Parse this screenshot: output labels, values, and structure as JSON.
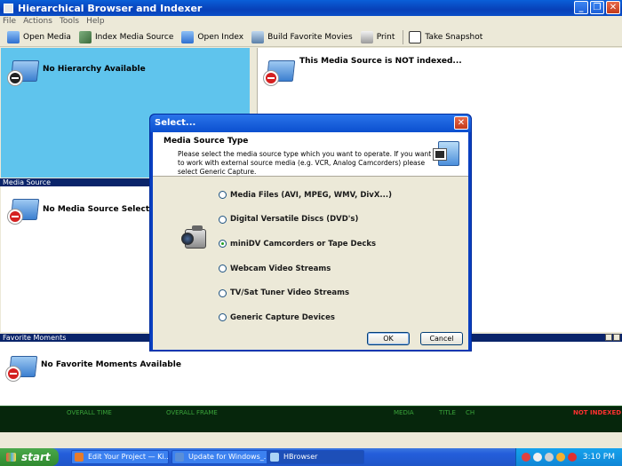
{
  "window": {
    "title": "Hierarchical Browser and Indexer",
    "controls": [
      "_",
      "❐",
      "✕"
    ]
  },
  "menu": [
    "File",
    "Actions",
    "Tools",
    "Help"
  ],
  "toolbar": {
    "open_media": "Open Media",
    "index_media_source": "Index Media Source",
    "open_index": "Open Index",
    "build_favorite_movies": "Build Favorite Movies",
    "print": "Print",
    "take_snapshot": "Take Snapshot"
  },
  "panes": {
    "hierarchy": "No Hierarchy Available",
    "right": "This Media Source is NOT indexed...",
    "media_source_header": "Media Source",
    "media_source": "No Media Source Selected",
    "favorite_header": "Favorite Moments",
    "favorite": "No Favorite Moments Available"
  },
  "status": {
    "overall_time": "OVERALL TIME",
    "overall_frame": "OVERALL FRAME",
    "media": "MEDIA",
    "title": "TITLE",
    "ch": "CH",
    "not_indexed": "NOT INDEXED"
  },
  "dialog": {
    "title": "Select...",
    "close": "✕",
    "heading": "Media Source Type",
    "description": "Please select the media source type which you want to operate. If you want to work with external source media (e.g. VCR, Analog Camcorders) please select Generic Capture.",
    "options": [
      "Media Files (AVI, MPEG, WMV, DivX...)",
      "Digital Versatile Discs (DVD's)",
      "miniDV Camcorders or Tape Decks",
      "Webcam Video Streams",
      "TV/Sat Tuner Video Streams",
      "Generic Capture Devices"
    ],
    "selected_index": 2,
    "ok": "OK",
    "cancel": "Cancel"
  },
  "taskbar": {
    "start": "start",
    "tasks": [
      "Edit Your Project — Ki...",
      "Update for Windows_...",
      "HBrowser"
    ],
    "active_task_index": 2,
    "clock": "3:10 PM"
  },
  "colors": {
    "title_blue": "#0a4fc8",
    "hierarchy_bg": "#5fc4ed",
    "section_header": "#0a246a",
    "status_bg": "#06260c",
    "status_green": "#3aa33a",
    "status_red": "#ff3030"
  }
}
